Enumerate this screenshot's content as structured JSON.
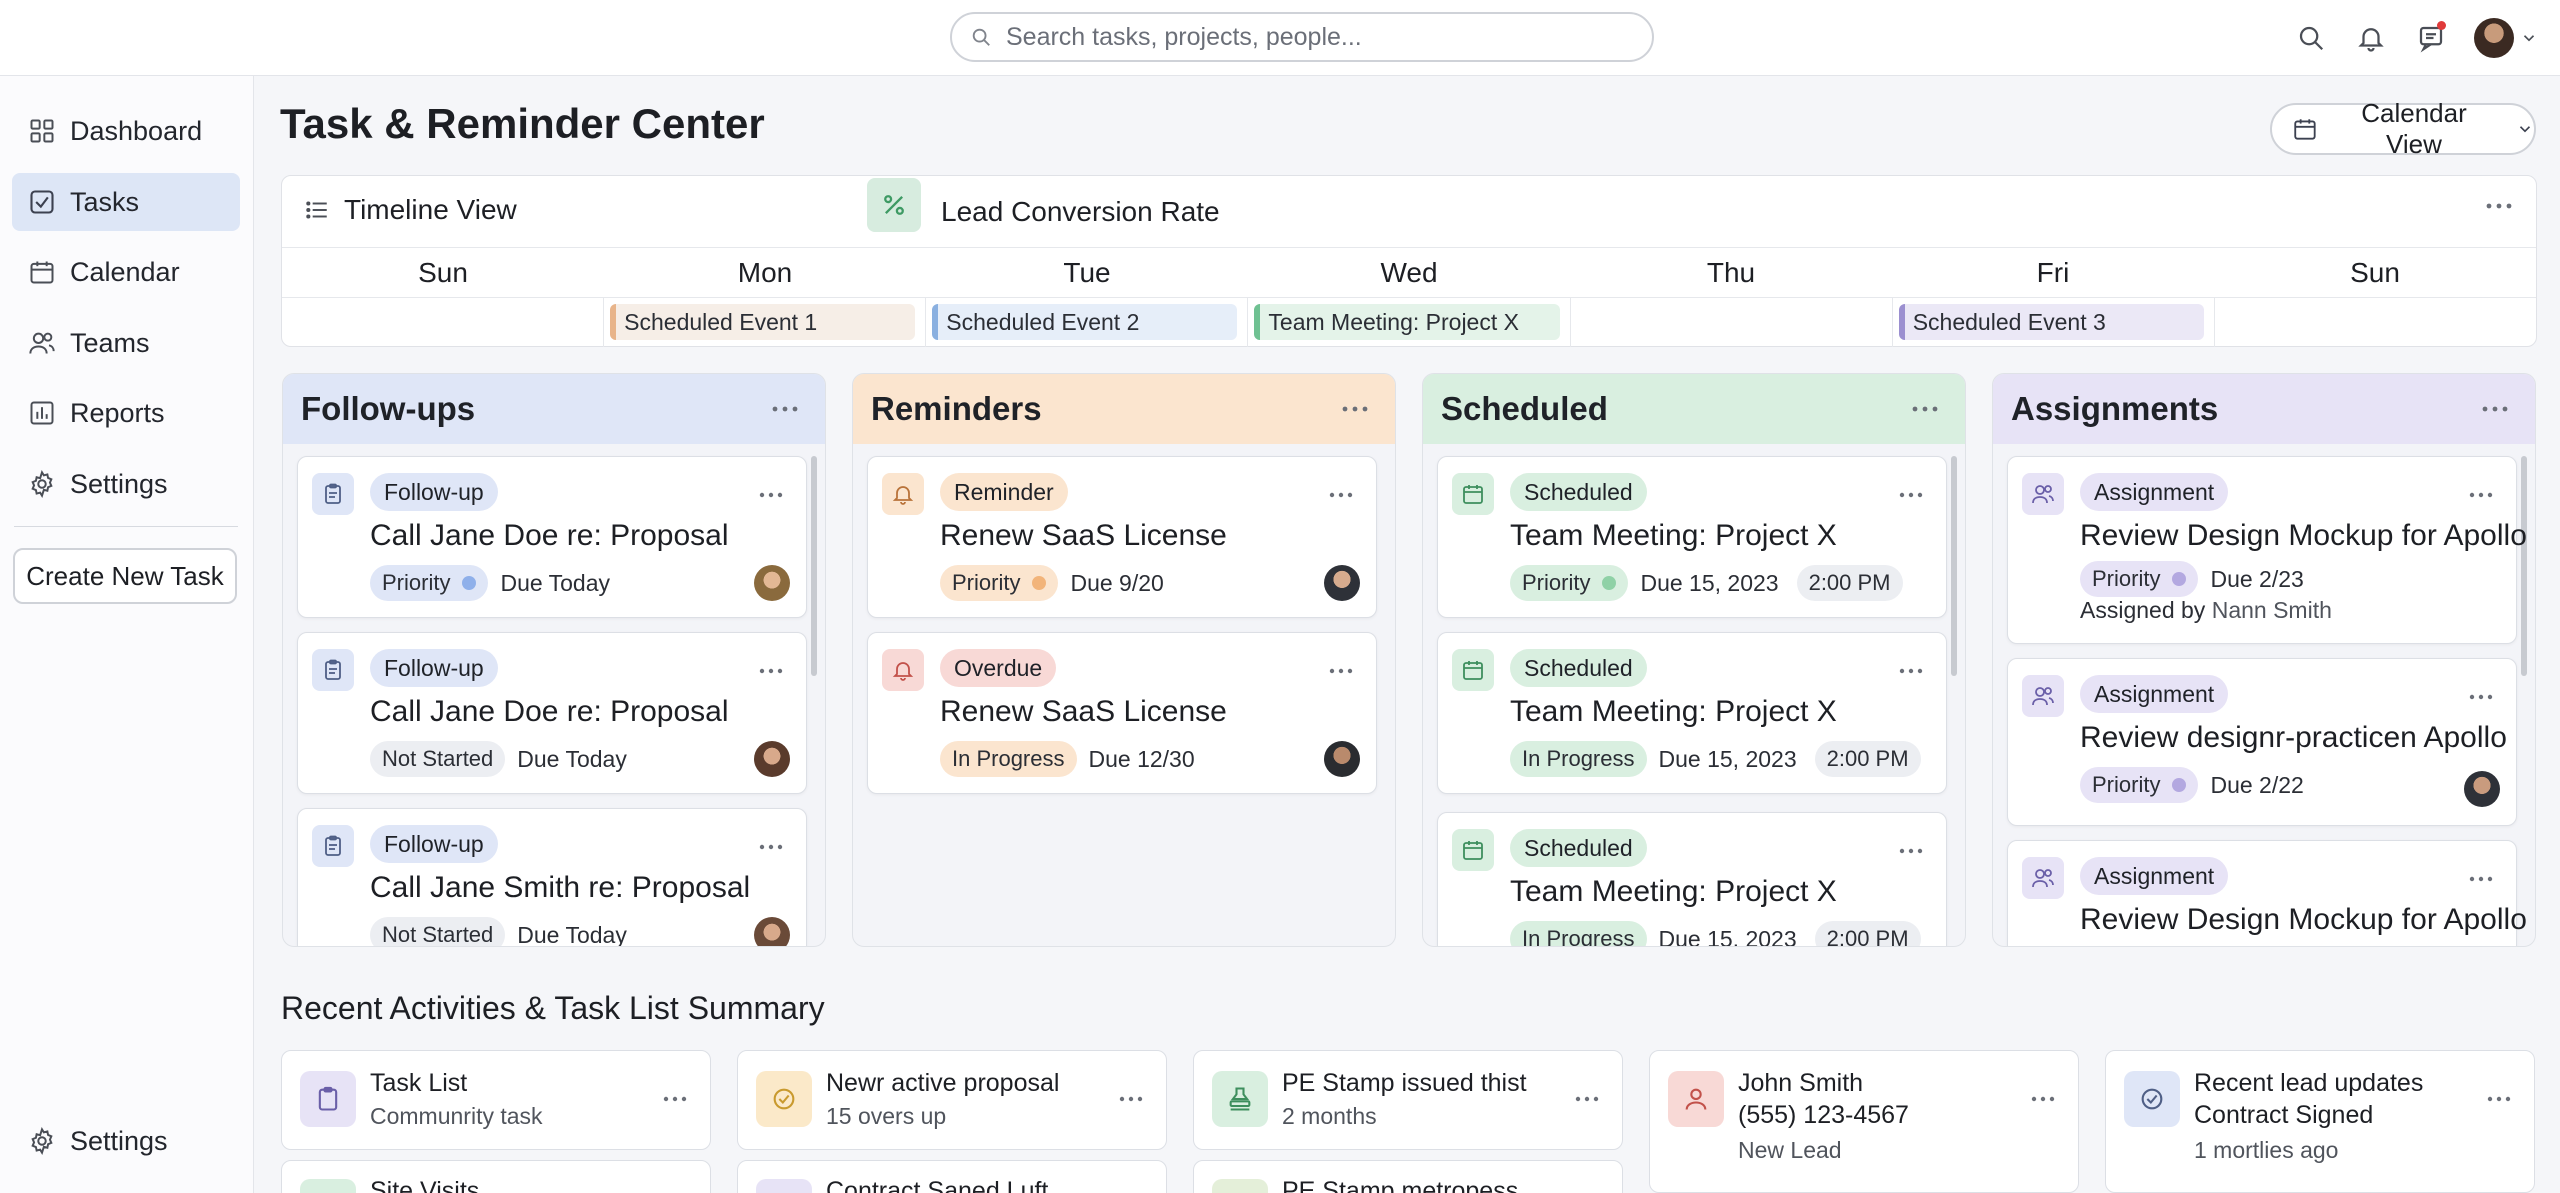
{
  "search": {
    "placeholder": "Search tasks, projects, people..."
  },
  "sidebar": {
    "items": [
      {
        "label": "Dashboard"
      },
      {
        "label": "Tasks"
      },
      {
        "label": "Calendar"
      },
      {
        "label": "Teams"
      },
      {
        "label": "Reports"
      },
      {
        "label": "Settings"
      }
    ],
    "create_label": "Create New Task",
    "bottom_settings": "Settings"
  },
  "page": {
    "title": "Task & Reminder Center",
    "view_label": "Calendar View"
  },
  "timeline": {
    "title": "Timeline View",
    "widget": "Lead Conversion Rate",
    "days": [
      "Sun",
      "Mon",
      "Tue",
      "Wed",
      "Thu",
      "Fri",
      "Sun"
    ],
    "events": [
      "",
      "Scheduled Event 1",
      "Scheduled Event 2",
      "Team Meeting: Project X",
      "",
      "Scheduled Event 3",
      ""
    ]
  },
  "columns": {
    "followups": {
      "title": "Follow-ups",
      "cards": [
        {
          "tag": "Follow-up",
          "title": "Call Jane Doe re: Proposal",
          "status": "Priority",
          "due": "Due Today"
        },
        {
          "tag": "Follow-up",
          "title": "Call Jane Doe re: Proposal",
          "status": "Not Started",
          "due": "Due Today"
        },
        {
          "tag": "Follow-up",
          "title": "Call Jane Smith re: Proposal",
          "status": "Not Started",
          "due": "Due Today"
        }
      ]
    },
    "reminders": {
      "title": "Reminders",
      "cards": [
        {
          "tag": "Reminder",
          "title": "Renew SaaS License",
          "status": "Priority",
          "due": "Due 9/20"
        },
        {
          "tag": "Overdue",
          "title": "Renew SaaS License",
          "status": "In Progress",
          "due": "Due 12/30"
        }
      ]
    },
    "scheduled": {
      "title": "Scheduled",
      "cards": [
        {
          "tag": "Scheduled",
          "title": "Team Meeting: Project X",
          "status": "Priority",
          "due": "Due 15, 2023",
          "time": "2:00 PM"
        },
        {
          "tag": "Scheduled",
          "title": "Team Meeting: Project X",
          "status": "In Progress",
          "due": "Due 15, 2023",
          "time": "2:00 PM"
        },
        {
          "tag": "Scheduled",
          "title": "Team Meeting: Project X",
          "status": "In Progress",
          "due": "Due 15, 2023",
          "time": "2:00 PM"
        }
      ]
    },
    "assignments": {
      "title": "Assignments",
      "cards": [
        {
          "tag": "Assignment",
          "title": "Review Design Mockup for Apollo",
          "status": "Priority",
          "due": "Due 2/23",
          "assigned_prefix": "Assigned by",
          "assigned_name": "Nann Smith"
        },
        {
          "tag": "Assignment",
          "title": "Review designr-practicen Apollo",
          "status": "Priority",
          "due": "Due 2/22"
        },
        {
          "tag": "Assignment",
          "title": "Review Design Mockup for Apollo"
        }
      ]
    }
  },
  "recent": {
    "title": "Recent Activities & Task List Summary",
    "cards": [
      {
        "title": "Task List",
        "sub": "Communrity task",
        "icon": "clipboard-icon"
      },
      {
        "title": "Newr active proposal",
        "sub": "15 overs up",
        "icon": "badge-icon"
      },
      {
        "title": "PE Stamp issued thist",
        "sub": "2 months",
        "icon": "stamp-icon"
      },
      {
        "title": "John Smith",
        "title2": "(555) 123-4567",
        "sub": "New Lead",
        "icon": "person-icon"
      },
      {
        "title": "Recent lead updates",
        "title2": "Contract Signed",
        "sub": "1 mortlies ago",
        "icon": "check-circle-icon"
      }
    ],
    "row2": [
      "Site Visits",
      "Contract Saned Luft",
      "PE Stamp metropess"
    ]
  },
  "colors": {
    "followups_head": "#dfe6f7",
    "reminders_head": "#fbe5cf",
    "scheduled_head": "#d9efe0",
    "assignments_head": "#e7e3f6",
    "active_nav": "#dde6f6"
  }
}
